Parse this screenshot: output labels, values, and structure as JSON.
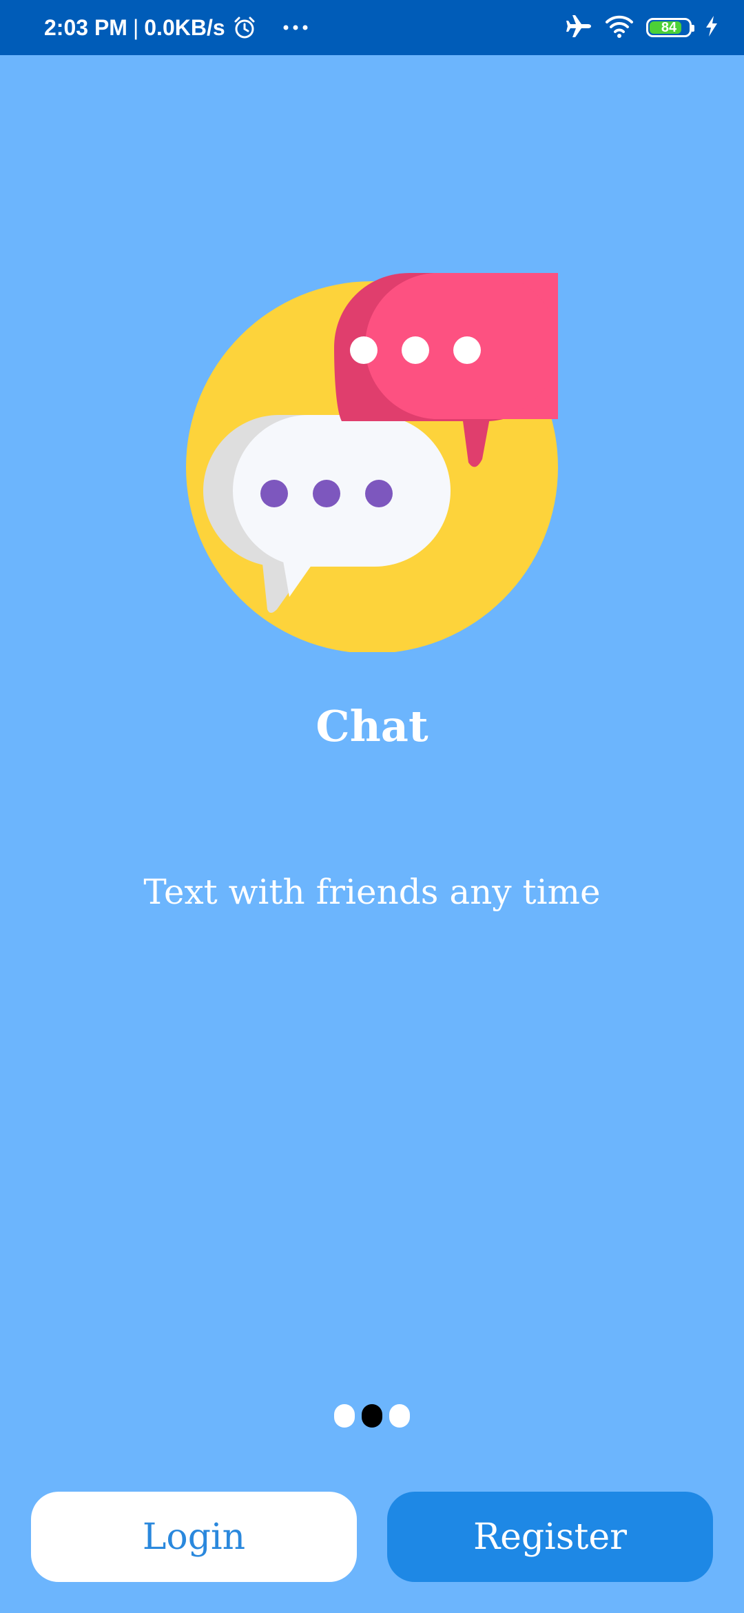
{
  "status_bar": {
    "time": "2:03 PM",
    "separator": "|",
    "network_speed": "0.0KB/s",
    "battery_level": "84",
    "icons": [
      "alarm-icon",
      "more-dots-icon",
      "airplane-mode-icon",
      "wifi-icon",
      "battery-icon",
      "charging-icon"
    ]
  },
  "onboarding": {
    "title": "Chat",
    "subtitle": "Text with friends any time",
    "page_indicator": {
      "pages": 3,
      "current": 2
    }
  },
  "buttons": {
    "login_label": "Login",
    "register_label": "Register"
  },
  "colors": {
    "background": "#6cb5fd",
    "status_bar": "#005cb8",
    "accent": "#1e88e5",
    "circle": "#fdd33b",
    "pink_bubble": "#fd5181",
    "white_bubble": "#f6f8fc",
    "purple_dots": "#7d57be"
  }
}
